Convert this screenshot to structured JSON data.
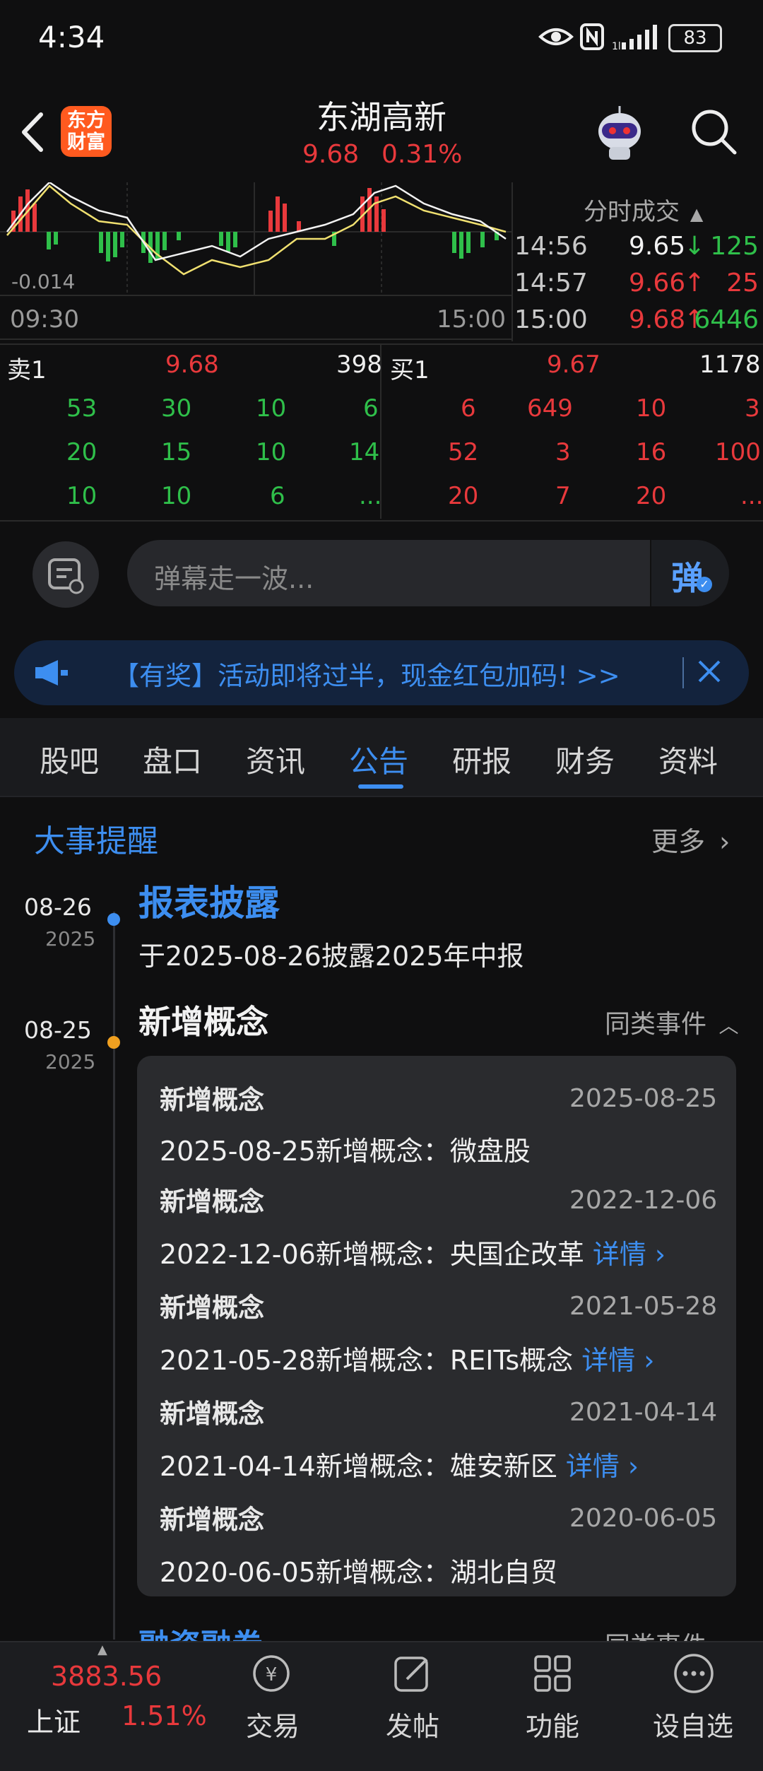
{
  "status_bar": {
    "time": "4:34",
    "battery": "83"
  },
  "header": {
    "logo_line1": "东方",
    "logo_line2": "财富",
    "stock_name": "东湖高新",
    "price": "9.68",
    "change_pct": "0.31%"
  },
  "chart": {
    "neg_label": "-0.014",
    "time_start": "09:30",
    "time_end": "15:00"
  },
  "ticks": {
    "header": "分时成交",
    "rows": [
      {
        "time": "14:56",
        "price": "9.65",
        "arrow": "↓",
        "vol": "125"
      },
      {
        "time": "14:57",
        "price": "9.66",
        "arrow": "↑",
        "vol": "25"
      },
      {
        "time": "15:00",
        "price": "9.68",
        "arrow": "↑",
        "vol": "6446"
      }
    ]
  },
  "orderbook": {
    "sell": {
      "label": "卖1",
      "price": "9.68",
      "vol": "398",
      "queue": [
        [
          "53",
          "30",
          "10",
          "6"
        ],
        [
          "20",
          "15",
          "10",
          "14"
        ],
        [
          "10",
          "10",
          "6",
          "..."
        ]
      ]
    },
    "buy": {
      "label": "买1",
      "price": "9.67",
      "vol": "1178",
      "queue": [
        [
          "6",
          "649",
          "10",
          "3"
        ],
        [
          "52",
          "3",
          "16",
          "100"
        ],
        [
          "20",
          "7",
          "20",
          "..."
        ]
      ]
    }
  },
  "danmaku": {
    "placeholder": "弹幕走一波...",
    "send_label": "弹"
  },
  "banner": {
    "text": "【有奖】活动即将过半，现金红包加码! >>"
  },
  "tabs": [
    "股吧",
    "盘口",
    "资讯",
    "公告",
    "研报",
    "财务",
    "资料"
  ],
  "events": {
    "title": "大事提醒",
    "more": "更多",
    "items": [
      {
        "date": "08-26",
        "year": "2025",
        "title": "报表披露",
        "desc": "于2025-08-26披露2025年中报"
      },
      {
        "date": "08-25",
        "year": "2025",
        "title": "新增概念",
        "similar": "同类事件"
      }
    ],
    "concepts": [
      {
        "title": "新增概念",
        "date": "2025-08-25",
        "desc": "2025-08-25新增概念：微盘股",
        "detail": ""
      },
      {
        "title": "新增概念",
        "date": "2022-12-06",
        "desc": "2022-12-06新增概念：央国企改革",
        "detail": "详情 ›"
      },
      {
        "title": "新增概念",
        "date": "2021-05-28",
        "desc": "2021-05-28新增概念：REITs概念",
        "detail": "详情 ›"
      },
      {
        "title": "新增概念",
        "date": "2021-04-14",
        "desc": "2021-04-14新增概念：雄安新区",
        "detail": "详情 ›"
      },
      {
        "title": "新增概念",
        "date": "2020-06-05",
        "desc": "2020-06-05新增概念：湖北自贸",
        "detail": ""
      }
    ],
    "peek_title": "融资融券",
    "peek_similar": "同类事件"
  },
  "bottom_nav": {
    "index_value": "3883.56",
    "index_name": "上证",
    "index_change": "1.51%",
    "items": [
      "交易",
      "发帖",
      "功能",
      "设自选"
    ]
  },
  "colors": {
    "up": "#e8393c",
    "down": "#2fbf4a",
    "accent": "#3d8ef0"
  }
}
